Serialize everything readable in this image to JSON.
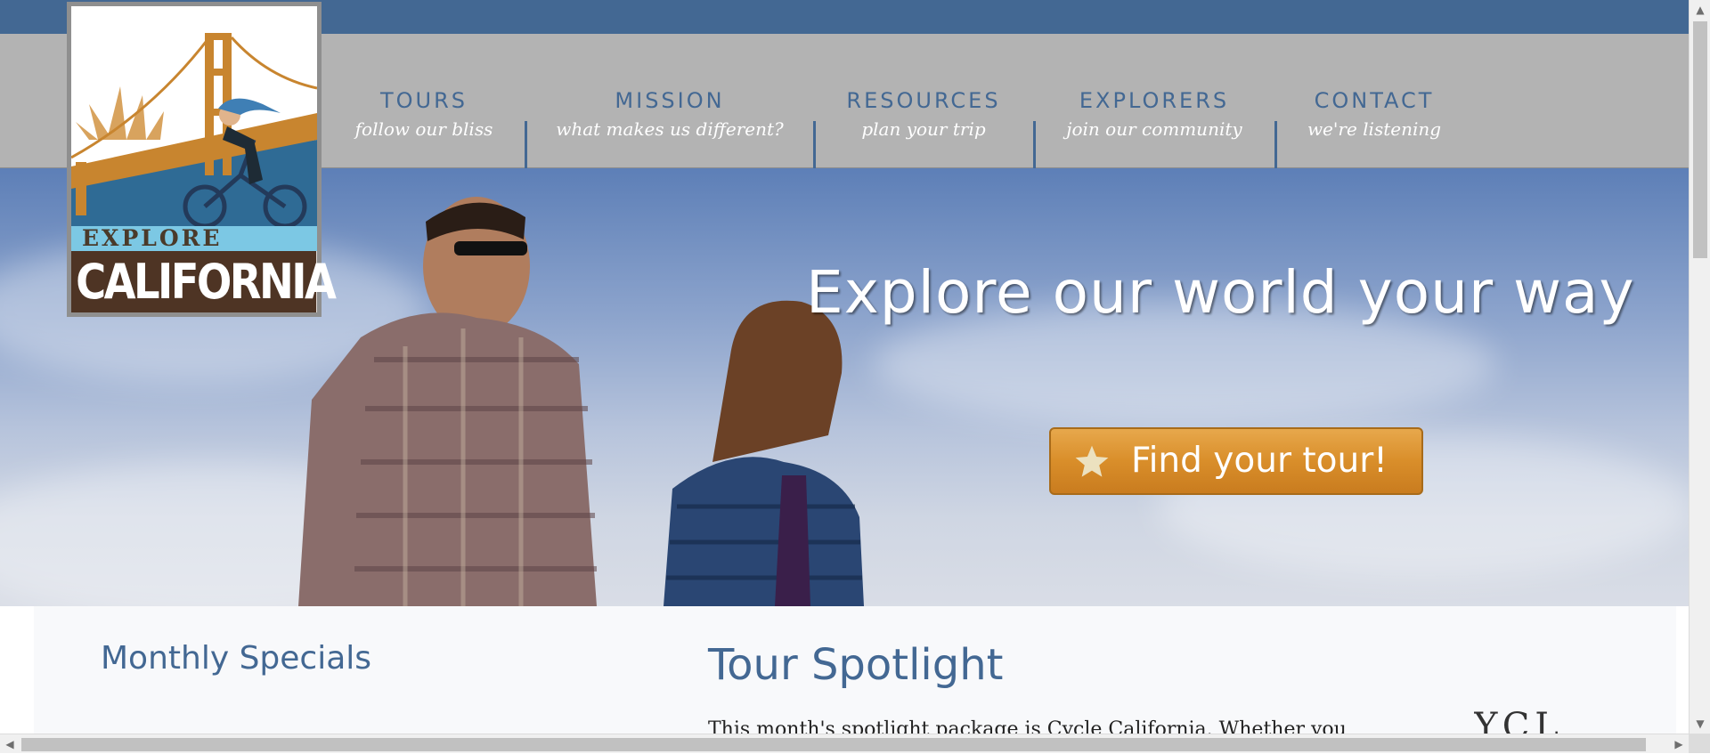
{
  "brand": {
    "logo_line1": "EXPLORE",
    "logo_line2": "CALIFORNIA",
    "colors": {
      "top_bar": "#436893",
      "nav_bar": "#b3b3b3",
      "accent": "#436893",
      "cta": "#d98e2a"
    }
  },
  "nav": {
    "items": [
      {
        "label": "TOURS",
        "tagline": "follow our bliss"
      },
      {
        "label": "MISSION",
        "tagline": "what makes us different?"
      },
      {
        "label": "RESOURCES",
        "tagline": "plan your trip"
      },
      {
        "label": "EXPLORERS",
        "tagline": "join our community"
      },
      {
        "label": "CONTACT",
        "tagline": "we're listening"
      }
    ]
  },
  "hero": {
    "headline": "Explore our world your way",
    "cta_label": "Find your tour!",
    "cta_icon": "star-icon"
  },
  "main": {
    "specials_title": "Monthly Specials",
    "spotlight_title": "Tour Spotlight",
    "spotlight_text": "This month's spotlight package is Cycle California. Whether you",
    "spotlight_image_text": "YCL"
  }
}
